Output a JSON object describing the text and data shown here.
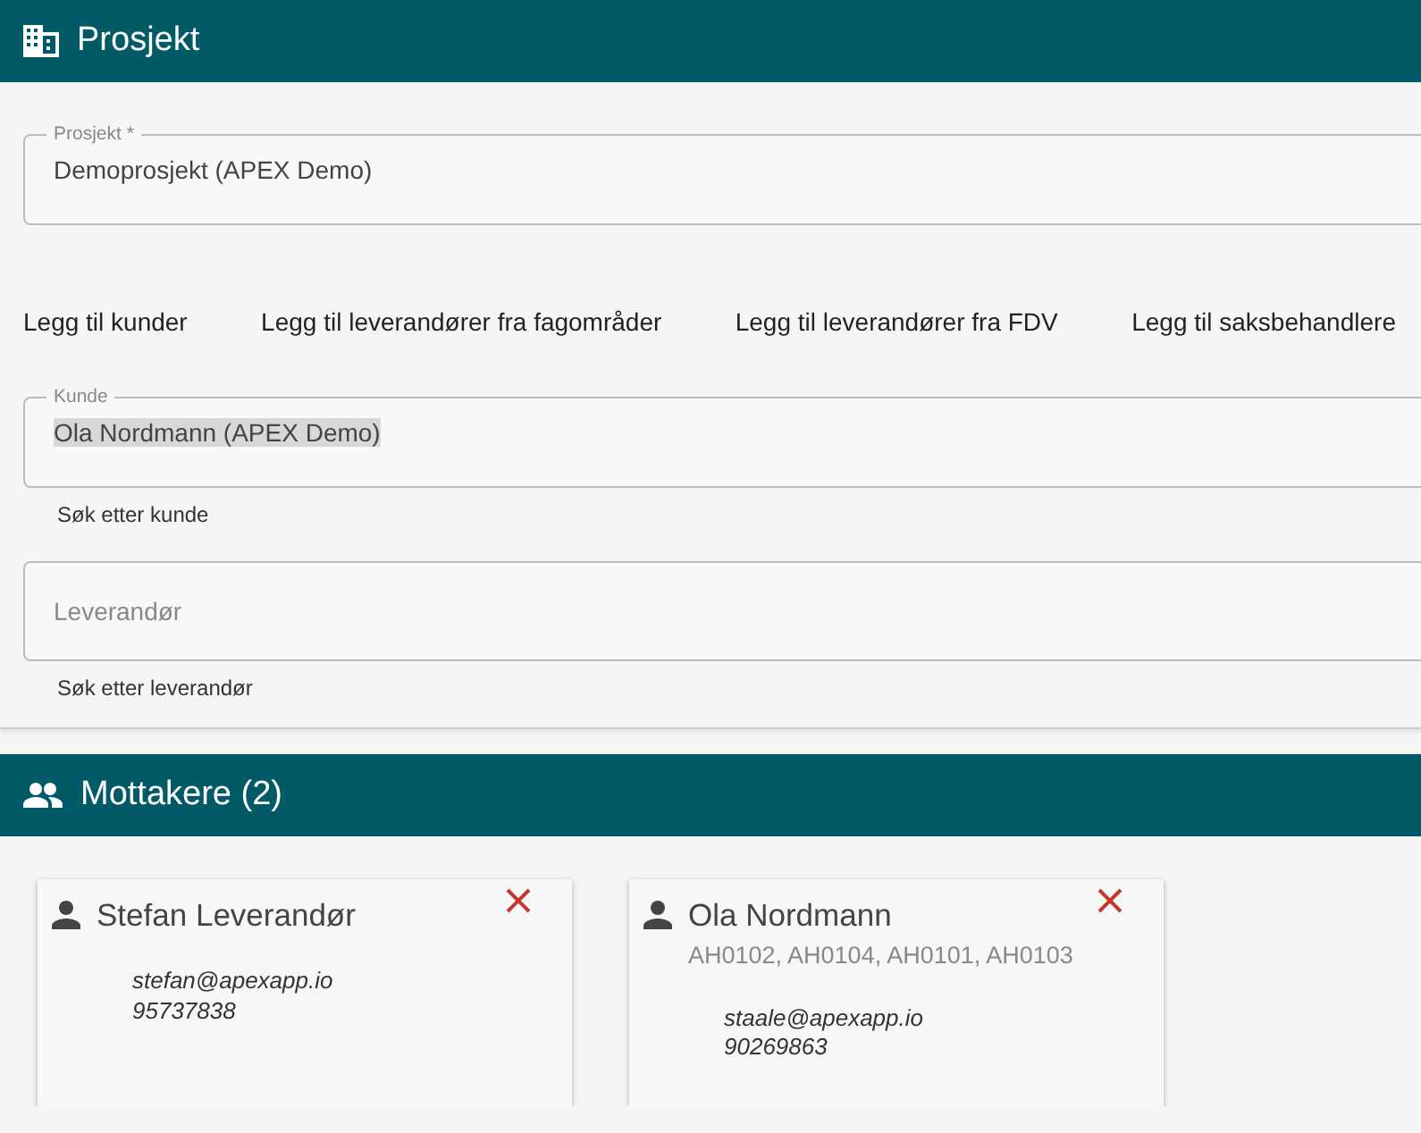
{
  "header": {
    "title": "Prosjekt"
  },
  "project_field": {
    "label": "Prosjekt *",
    "value": "Demoprosjekt (APEX Demo)"
  },
  "links": [
    "Legg til kunder",
    "Legg til leverandører fra fagområder",
    "Legg til leverandører fra FDV",
    "Legg til saksbehandlere"
  ],
  "customer_field": {
    "label": "Kunde",
    "value": "Ola Nordmann (APEX Demo)",
    "highlighted": true,
    "help": "Søk etter kunde"
  },
  "supplier_field": {
    "placeholder": "Leverandør",
    "help": "Søk etter leverandør"
  },
  "recipients": {
    "title": "Mottakere (2)",
    "cards": [
      {
        "name": "Stefan Leverandør",
        "email": "stefan@apexapp.io",
        "phone": "95737838"
      },
      {
        "name": "Ola Nordmann",
        "codes": "AH0102, AH0104, AH0101, AH0103",
        "email": "staale@apexapp.io",
        "phone": "90269863"
      }
    ]
  }
}
